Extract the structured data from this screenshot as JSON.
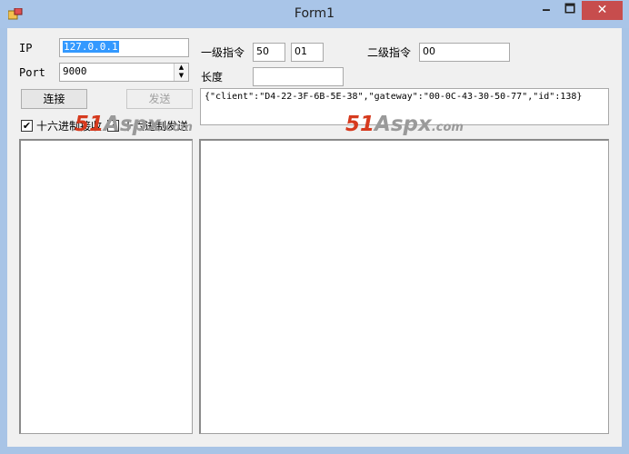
{
  "window": {
    "title": "Form1",
    "minimize": "🗕",
    "maximize": "🗖",
    "close": "✕"
  },
  "left": {
    "ip_label": "IP",
    "ip_value": "127.0.0.1",
    "port_label": "Port",
    "port_value": "9000",
    "connect_button": "连接",
    "send_button": "发送",
    "hex_receive": {
      "label": "十六进制接收",
      "checked": true
    },
    "hex_send": {
      "label": "十六进制发送",
      "checked": true
    }
  },
  "right": {
    "cmd1_label": "一级指令",
    "cmd1_value_a": "50",
    "cmd1_value_b": "01",
    "cmd2_label": "二级指令",
    "cmd2_value": "00",
    "length_label": "长度",
    "length_value": "",
    "payload_text": "{\"client\":\"D4-22-3F-6B-5E-38\",\"gateway\":\"00-0C-43-30-50-77\",\"id\":138}"
  },
  "watermark": {
    "part1": "51",
    "part2": "Aspx",
    "part3": ".com"
  },
  "colors": {
    "accent": "#3399ff",
    "close": "#c74d4d",
    "watermark_red": "#d63a1e"
  }
}
